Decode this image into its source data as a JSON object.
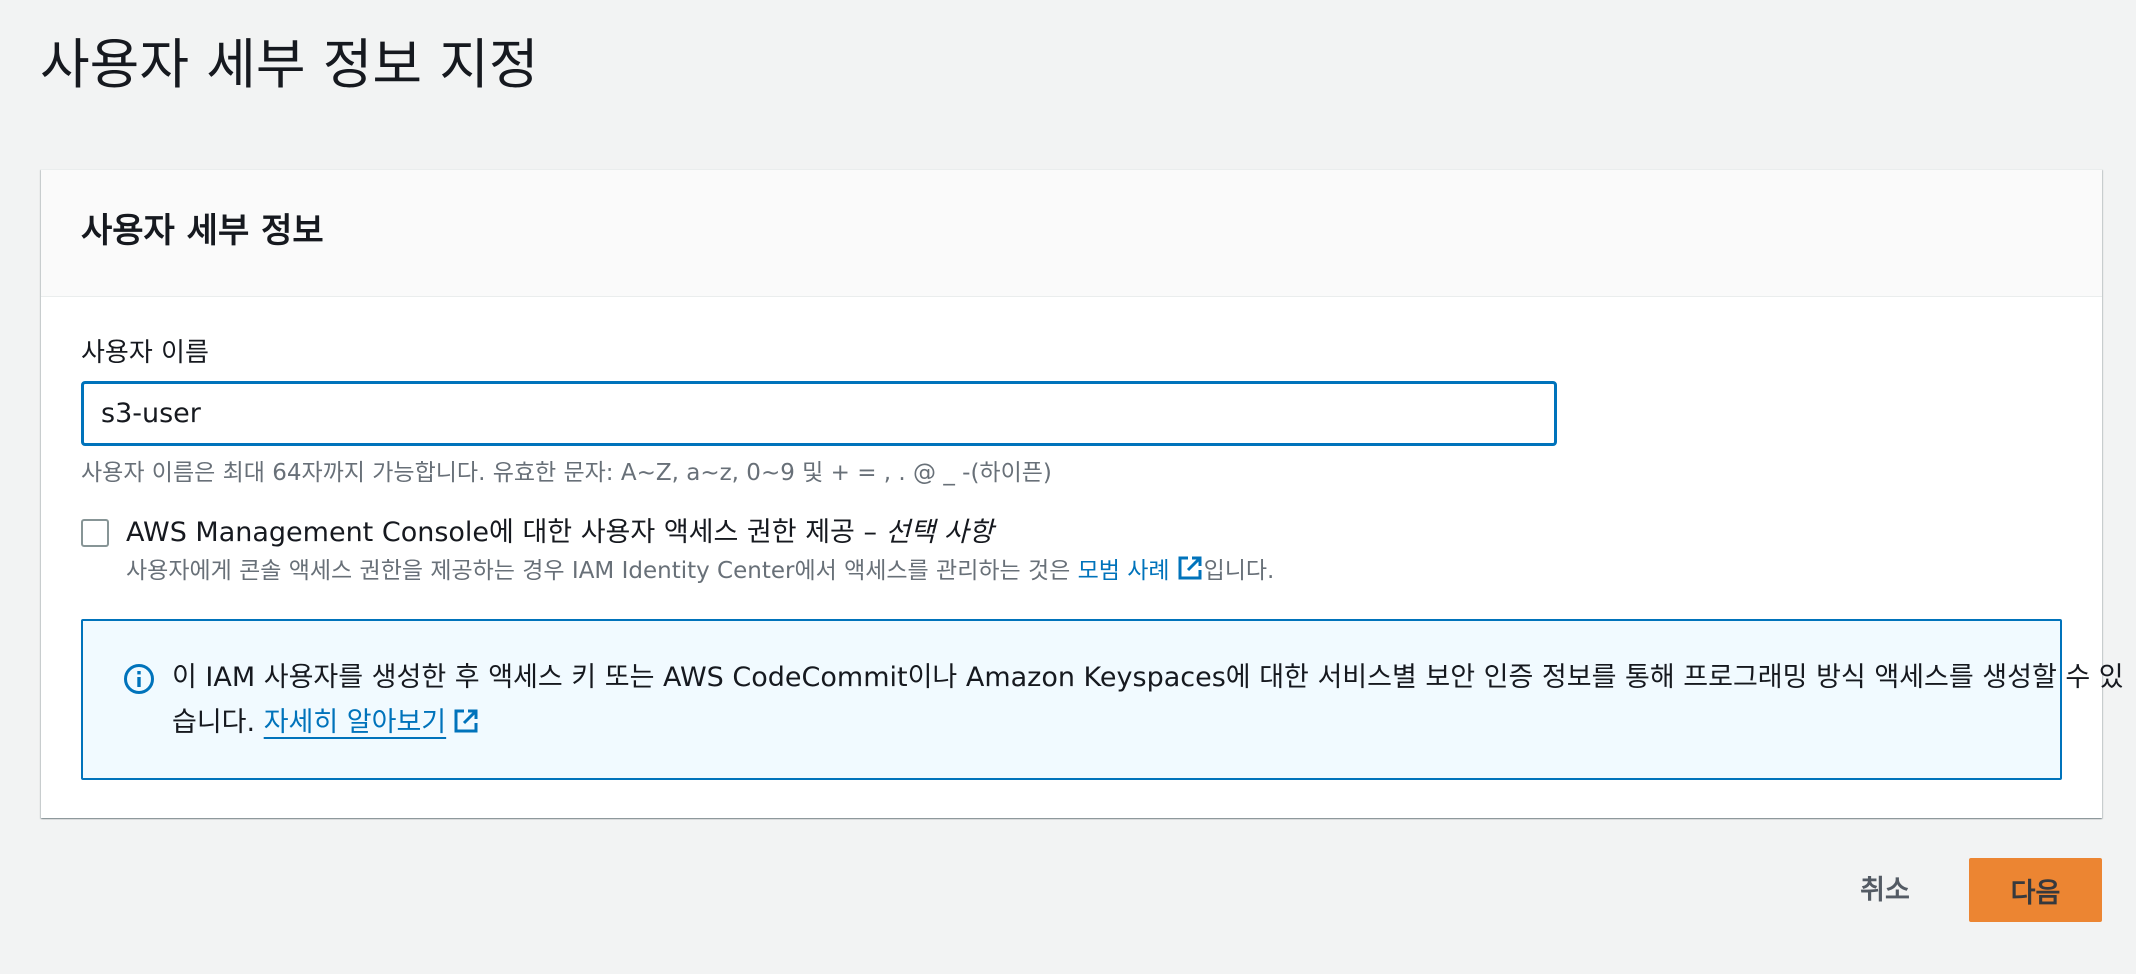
{
  "page": {
    "title": "사용자 세부 정보 지정"
  },
  "card": {
    "title": "사용자 세부 정보",
    "username": {
      "label": "사용자 이름",
      "value": "s3-user",
      "constraint": "사용자 이름은 최대 64자까지 가능합니다. 유효한 문자: A~Z, a~z, 0~9 및 + = , . @ _ -(하이픈)"
    },
    "console_access": {
      "label": "AWS Management Console에 대한 사용자 액세스 권한 제공 – ",
      "optional": "선택 사항",
      "checked": false,
      "desc_prefix": "사용자에게 콘솔 액세스 권한을 제공하는 경우 IAM Identity Center에서 액세스를 관리하는 것은 ",
      "desc_link": "모범 사례",
      "desc_suffix": "입니다."
    },
    "info": {
      "text": "이 IAM 사용자를 생성한 후 액세스 키 또는 AWS CodeCommit이나 Amazon Keyspaces에 대한 서비스별 보안 인증 정보를 통해 프로그래밍 방식 액세스를 생성할 수 있습니다. ",
      "link": "자세히 알아보기"
    }
  },
  "actions": {
    "cancel_label": "취소",
    "next_label": "다음"
  },
  "colors": {
    "accent": "#0073bb",
    "primary_button": "#ec7211",
    "background": "#f2f3f3"
  },
  "icons": [
    "external-link-icon",
    "info-icon"
  ]
}
